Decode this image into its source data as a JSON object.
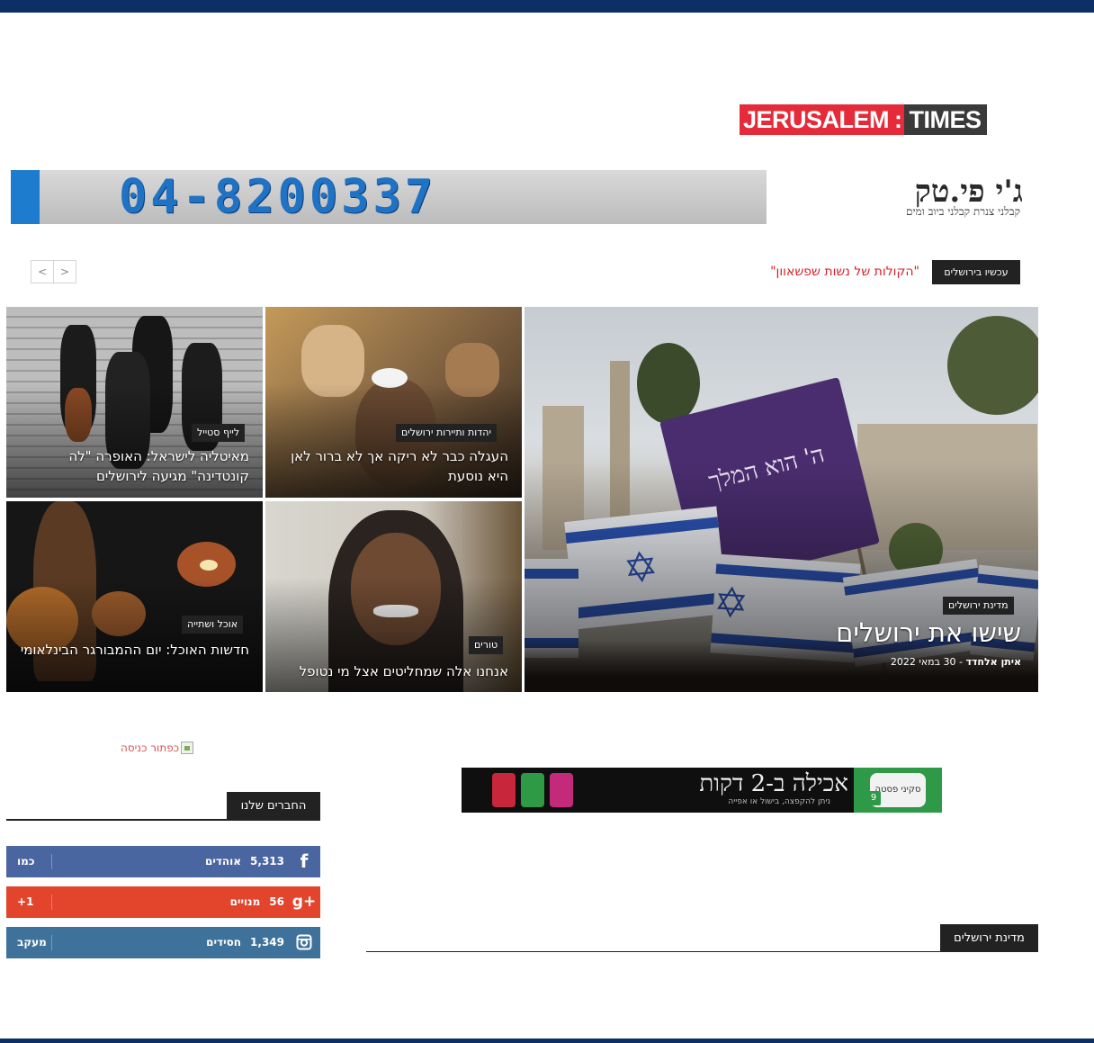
{
  "logo": {
    "part1": "JERUSALEM",
    "separator": ":",
    "part2": "TIMES"
  },
  "header_ad": {
    "phone": "04-8200337",
    "brand": "ג'י פי.טק",
    "tagline": "קבלני צנרת   קבלני ביוב ומים"
  },
  "breaking": {
    "label": "עכשיו בירושלים",
    "headline": "\"הקולות של נשות שפשאוון\""
  },
  "slider_nav": {
    "prev": "<",
    "next": ">"
  },
  "featured": {
    "main": {
      "category": "מדינת ירושלים",
      "title": "שישו את ירושלים",
      "author": "איתן אלחדד",
      "date": "30 במאי 2022",
      "date_sep": " - ",
      "flag_text": "ה' הוא המלך"
    },
    "tiles": [
      {
        "category": "יהדות ותיירות ירושלים",
        "title": "העגלה כבר לא ריקה אך לא ברור לאן היא נוסעת"
      },
      {
        "category": "לייף סטייל",
        "title": "מאיטליה לישראל: האופרה \"לה קונטדינה\" מגיעה לירושלים"
      },
      {
        "category": "טורים",
        "title": "אנחנו אלה שמחליטים אצל מי נטופל"
      },
      {
        "category": "אוכל ושתייה",
        "title": "חדשות האוכל: יום ההמבורגר הבינלאומי"
      }
    ]
  },
  "sidebar": {
    "entry_image_alt": "כפתור כניסה",
    "friends_title": "החברים שלנו",
    "social": [
      {
        "network": "facebook",
        "icon": "f",
        "count": "5,313",
        "unit": "אוהדים",
        "action": "כמו",
        "color": "#4a66a0"
      },
      {
        "network": "google-plus",
        "icon": "g+",
        "count": "56",
        "unit": "מנויים",
        "action": "1+",
        "color": "#e2442c"
      },
      {
        "network": "instagram",
        "icon": "instagram-icon",
        "count": "1,349",
        "unit": "חסידים",
        "action": "מעקב",
        "color": "#3f729b"
      }
    ]
  },
  "food_ad": {
    "title": "אכילה ב-2 דקות",
    "subtitle": "ניתן להקפצה, בישול או אפייה",
    "scale_label": "סקיני פסטה",
    "scale_number": "9"
  },
  "section": {
    "title": "מדינת ירושלים"
  }
}
